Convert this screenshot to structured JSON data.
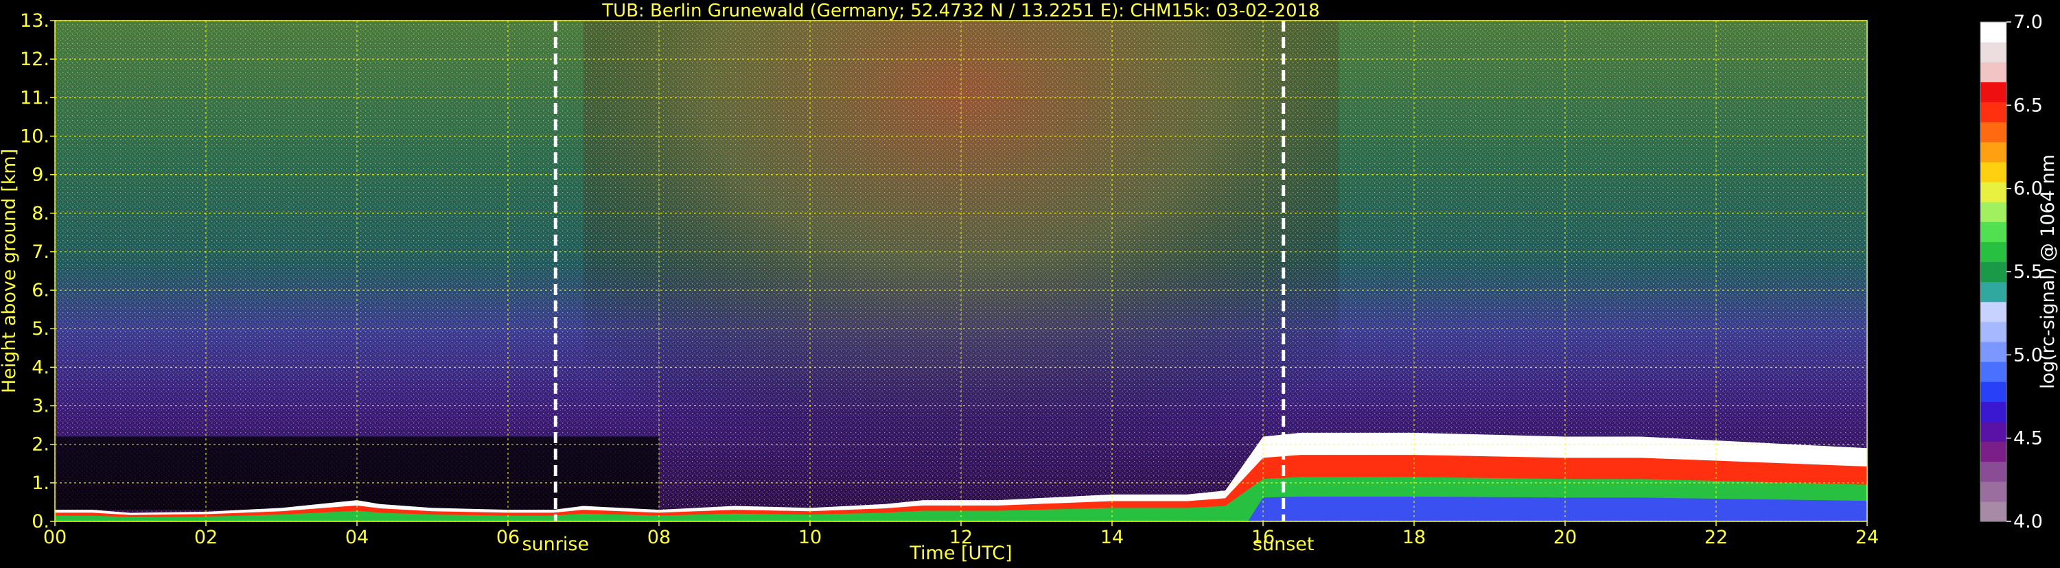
{
  "chart_data": {
    "type": "heatmap",
    "title": "TUB: Berlin Grunewald (Germany; 52.4732 N / 13.2251 E):    CHM15k: 03-02-2018",
    "xlabel": "Time [UTC]",
    "ylabel": "Height above ground [km]",
    "xlim": [
      0,
      24
    ],
    "ylim": [
      0,
      13
    ],
    "x_tick_labels": [
      "00",
      "02",
      "04",
      "06",
      "08",
      "10",
      "12",
      "14",
      "16",
      "18",
      "20",
      "22",
      "24"
    ],
    "y_tick_labels": [
      "0.",
      "1.",
      "2.",
      "3.",
      "4.",
      "5.",
      "6.",
      "7.",
      "8.",
      "9.",
      "10.",
      "11.",
      "12.",
      "13."
    ],
    "grid": true,
    "annotations": [
      {
        "label": "sunrise",
        "x": 6.63
      },
      {
        "label": "sunset",
        "x": 16.27
      }
    ],
    "colorbar": {
      "label": "log(rc-signal) @ 1064 nm",
      "range": [
        4.0,
        7.0
      ],
      "tick_labels": [
        "4.0",
        "4.5",
        "5.0",
        "5.5",
        "6.0",
        "6.5",
        "7.0"
      ],
      "colors": [
        "#a78aa6",
        "#9a6fa0",
        "#8a4c94",
        "#7a1f88",
        "#5a12a6",
        "#3a18d2",
        "#2840f8",
        "#4a70ff",
        "#7a98ff",
        "#a6b8ff",
        "#c8d2ff",
        "#30a8a0",
        "#1a9a48",
        "#28c040",
        "#50e050",
        "#a0f060",
        "#e8f040",
        "#ffd010",
        "#ffa010",
        "#ff6a10",
        "#ff3010",
        "#ee1010",
        "#f2c4c4",
        "#ecdede",
        "#ffffff"
      ]
    },
    "boundary_layer": {
      "x": [
        0,
        0.5,
        1,
        2,
        3,
        4,
        4.3,
        5,
        6,
        6.6,
        7,
        7.5,
        8,
        9,
        10,
        11,
        11.5,
        12,
        12.5,
        13,
        14,
        15,
        15.5,
        16,
        16.5,
        17,
        18,
        19,
        20,
        21,
        22,
        23,
        24
      ],
      "y": [
        0.3,
        0.3,
        0.22,
        0.25,
        0.35,
        0.55,
        0.45,
        0.35,
        0.3,
        0.3,
        0.4,
        0.35,
        0.3,
        0.4,
        0.35,
        0.45,
        0.55,
        0.55,
        0.55,
        0.6,
        0.7,
        0.7,
        0.8,
        2.2,
        2.3,
        2.3,
        2.3,
        2.25,
        2.2,
        2.2,
        2.1,
        2.0,
        1.9
      ]
    },
    "noise": {
      "night_top_km": 13,
      "day_peak_x": 12.5
    }
  }
}
